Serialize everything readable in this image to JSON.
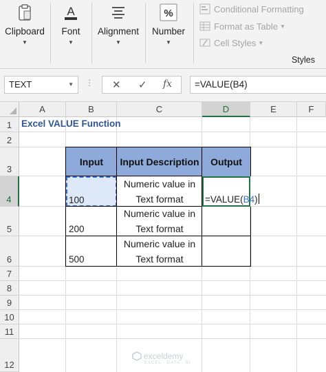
{
  "ribbon": {
    "groups": [
      {
        "label": "Clipboard",
        "icon": "clipboard-icon"
      },
      {
        "label": "Font",
        "icon": "font-color-icon"
      },
      {
        "label": "Alignment",
        "icon": "align-lines-icon"
      },
      {
        "label": "Number",
        "icon": "percent-icon"
      }
    ],
    "styles": {
      "conditional_formatting": "Conditional Formatting",
      "format_as_table": "Format as Table",
      "cell_styles": "Cell Styles",
      "group_label": "Styles"
    }
  },
  "formula_bar": {
    "name_box": "TEXT",
    "formula": "=VALUE(B4)",
    "buttons": {
      "cancel": "✕",
      "enter": "✓",
      "fx": "fx"
    }
  },
  "columns": [
    "A",
    "B",
    "C",
    "D",
    "E",
    "F"
  ],
  "rows": [
    "1",
    "2",
    "3",
    "4",
    "5",
    "6",
    "7",
    "8",
    "9",
    "10",
    "11",
    "12"
  ],
  "sheet": {
    "title": "Excel VALUE Function",
    "headers": {
      "input": "Input",
      "description": "Input Description",
      "output": "Output"
    },
    "rows": [
      {
        "input": "100",
        "desc_line1": "Numeric value in",
        "desc_line2": "Text format"
      },
      {
        "input": "200",
        "desc_line1": "Numeric value in",
        "desc_line2": "Text format"
      },
      {
        "input": "500",
        "desc_line1": "Numeric value in",
        "desc_line2": "Text format"
      }
    ],
    "editing": {
      "prefix": "=VALUE(",
      "ref": "B4",
      "suffix": ")"
    }
  },
  "colors": {
    "header_fill": "#8eaadb",
    "title_color": "#2e5597",
    "active_green": "#217346",
    "ref_blue": "#3d74d1"
  },
  "watermark": {
    "name": "exceldemy",
    "tagline": "EXCEL · DATA · BI"
  }
}
